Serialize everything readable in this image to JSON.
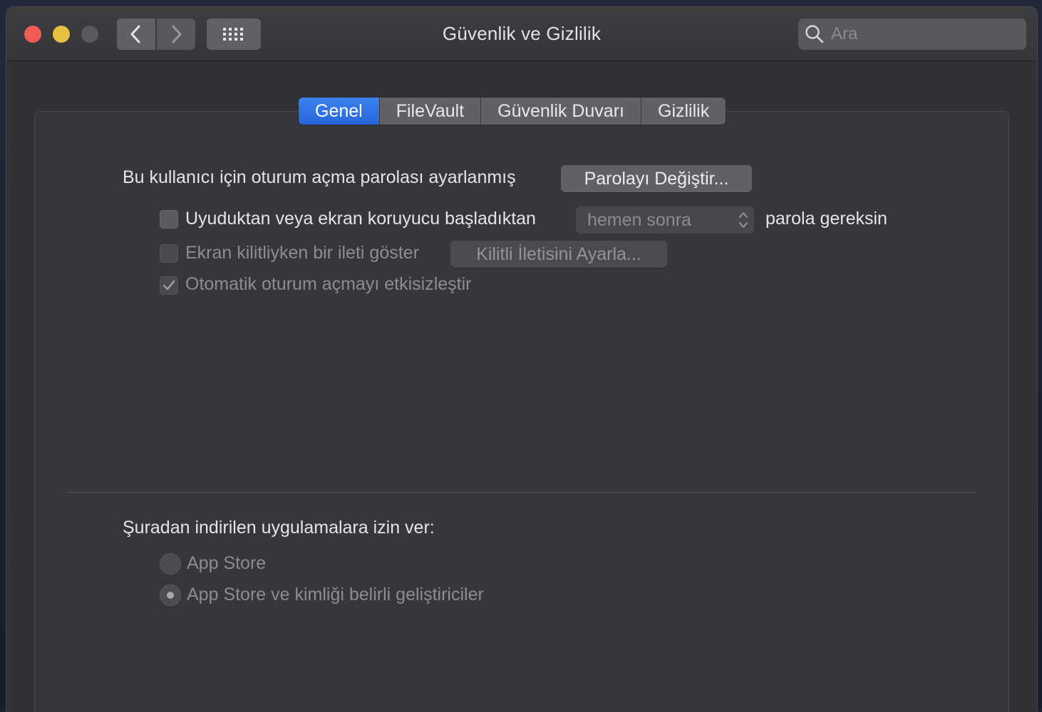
{
  "window": {
    "title": "Güvenlik ve Gizlilik"
  },
  "toolbar": {
    "back_icon": "chevron-left-icon",
    "forward_icon": "chevron-right-icon",
    "grid_icon": "show-all-grid-icon"
  },
  "search": {
    "placeholder": "Ara",
    "value": ""
  },
  "tabs": [
    {
      "label": "Genel",
      "active": true
    },
    {
      "label": "FileVault",
      "active": false
    },
    {
      "label": "Güvenlik Duvarı",
      "active": false
    },
    {
      "label": "Gizlilik",
      "active": false
    }
  ],
  "general": {
    "password_set_text": "Bu kullanıcı için oturum açma parolası ayarlanmış",
    "change_password_button": "Parolayı Değiştir...",
    "require_password": {
      "label": "Uyuduktan veya ekran koruyucu başladıktan",
      "checked": false,
      "select_value": "hemen sonra",
      "suffix": "parola gereksin"
    },
    "show_message": {
      "label": "Ekran kilitliyken bir ileti göster",
      "checked": false,
      "enabled": false,
      "button": "Kilitli İletisini Ayarla..."
    },
    "disable_auto_login": {
      "label": "Otomatik oturum açmayı etkisizleştir",
      "checked": true,
      "enabled": false
    }
  },
  "downloads": {
    "heading": "Şuradan indirilen uygulamalara izin ver:",
    "options": [
      {
        "label": "App Store",
        "selected": false
      },
      {
        "label": "App Store ve kimliği belirli geliştiriciler",
        "selected": true
      }
    ]
  },
  "colors": {
    "close": "#ee5c55",
    "minimize": "#e7c041",
    "zoom_disabled": "#5a5a5d",
    "accent_tab": "#2f72e4",
    "window_bg": "#323236"
  }
}
